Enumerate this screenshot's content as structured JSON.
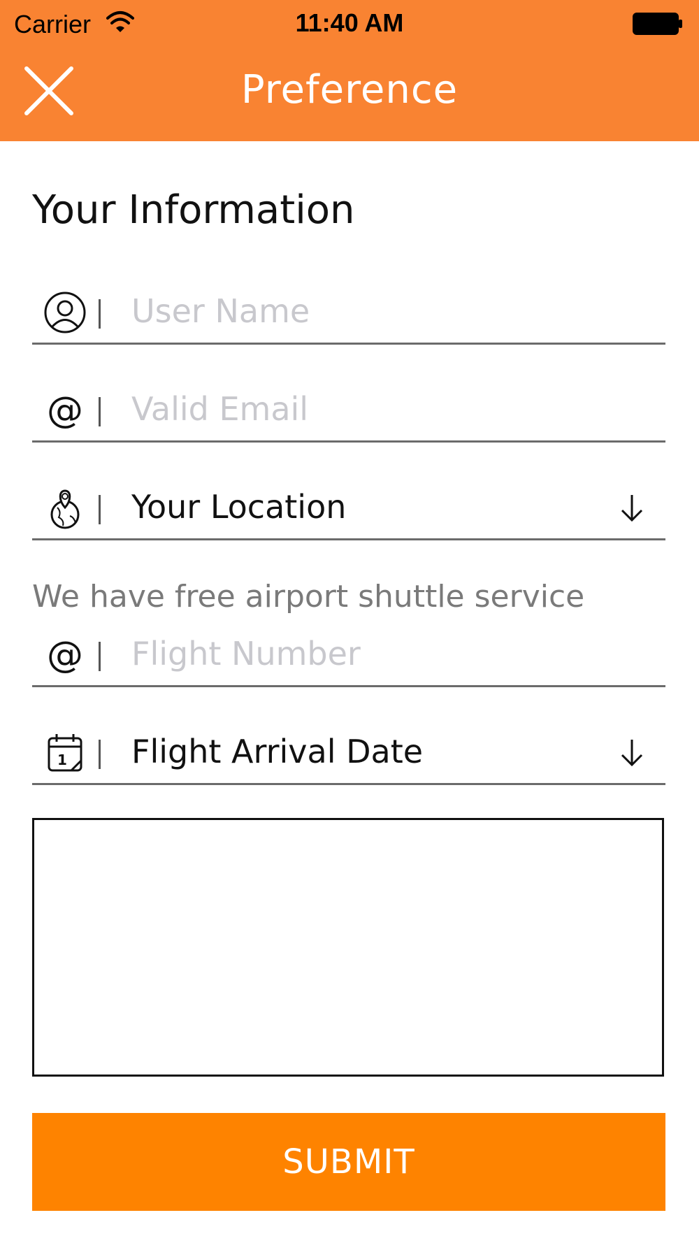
{
  "status_bar": {
    "carrier": "Carrier",
    "time": "11:40 AM",
    "wifi_icon": "wifi-icon",
    "battery_icon": "battery-icon"
  },
  "header": {
    "title": "Preference",
    "close_icon": "close-icon",
    "background_color": "#f98332"
  },
  "section": {
    "title": "Your Information"
  },
  "fields": {
    "user_name": {
      "icon": "user-icon",
      "placeholder": "User Name",
      "value": ""
    },
    "email": {
      "icon": "at-icon",
      "placeholder": "Valid Email",
      "value": ""
    },
    "location": {
      "icon": "globe-pin-icon",
      "value": "Your Location",
      "dropdown_icon": "arrow-down-icon"
    },
    "flight_number": {
      "icon": "at-icon",
      "placeholder": "Flight Number",
      "value": ""
    },
    "arrival_date": {
      "icon": "calendar-icon",
      "value": "Flight Arrival Date",
      "dropdown_icon": "arrow-down-icon"
    }
  },
  "shuttle_hint": "We have free airport shuttle service",
  "notes": {
    "value": ""
  },
  "submit": {
    "label": "SUBMIT",
    "color": "#fe8300"
  }
}
